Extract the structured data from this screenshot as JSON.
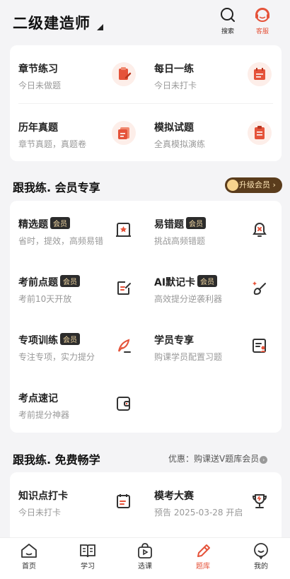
{
  "header": {
    "title": "二级建造师",
    "search_label": "搜索",
    "service_label": "客服"
  },
  "top_card": [
    {
      "name": "章节练习",
      "sub": "今日未做题",
      "icon": "clipboard-pen-icon"
    },
    {
      "name": "每日一练",
      "sub": "今日未打卡",
      "icon": "calendar-icon"
    },
    {
      "name": "历年真题",
      "sub": "章节真题，真题卷",
      "icon": "document-stack-icon"
    },
    {
      "name": "模拟试题",
      "sub": "全真模拟演练",
      "icon": "checklist-icon"
    }
  ],
  "member_section": {
    "title": "跟我练. 会员专享",
    "upgrade_label": "升级会员",
    "badge": "会员",
    "items": [
      {
        "name": "精选题",
        "sub": "省时，提效，高频易错",
        "icon": "scroll-star-icon",
        "member": true
      },
      {
        "name": "易错题",
        "sub": "挑战高频错题",
        "icon": "bell-x-icon",
        "member": true
      },
      {
        "name": "考前点题",
        "sub": "考前10天开放",
        "icon": "edit-note-icon",
        "member": true
      },
      {
        "name": "AI默记卡",
        "sub": "高效提分逆袭利器",
        "icon": "magic-brush-icon",
        "member": true
      },
      {
        "name": "专项训练",
        "sub": "专注专项，实力提分",
        "icon": "quill-icon",
        "member": true
      },
      {
        "name": "学员专享",
        "sub": "购课学员配置习题",
        "icon": "student-card-icon",
        "member": false
      },
      {
        "name": "考点速记",
        "sub": "考前提分神器",
        "icon": "wallet-book-icon",
        "member": false
      }
    ]
  },
  "free_section": {
    "title": "跟我练. 免费畅学",
    "promo": "优惠：购课送V题库会员",
    "items": [
      {
        "name": "知识点打卡",
        "sub": "今日未打卡",
        "icon": "calendar-check-icon"
      },
      {
        "name": "模考大赛",
        "sub": "预告 2025-03-28 开启",
        "icon": "trophy-icon"
      }
    ]
  },
  "tabbar": [
    {
      "label": "首页",
      "icon": "home-icon"
    },
    {
      "label": "学习",
      "icon": "book-icon"
    },
    {
      "label": "选课",
      "icon": "play-bag-icon"
    },
    {
      "label": "题库",
      "icon": "pencil-icon",
      "active": true
    },
    {
      "label": "我的",
      "icon": "profile-icon"
    }
  ],
  "colors": {
    "accent": "#e5533a",
    "background": "#f4f4f6",
    "badge_bg": "#2c2c2c",
    "badge_text": "#f3d9a4"
  }
}
